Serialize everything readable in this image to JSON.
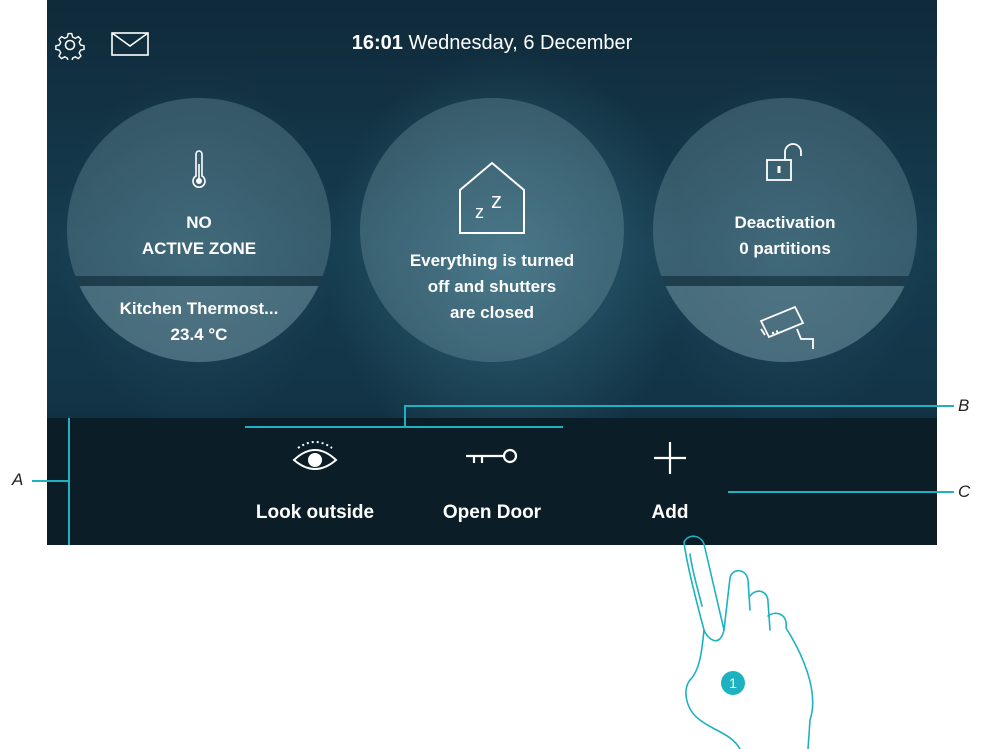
{
  "header": {
    "time": "16:01",
    "date": "Wednesday, 6 December",
    "icons": {
      "settings": "gear-icon",
      "messages": "mail-icon"
    }
  },
  "widgets": {
    "climate": {
      "icon": "thermometer-icon",
      "status_line1": "NO",
      "status_line2": "ACTIVE ZONE",
      "thermostat_name": "Kitchen Thermost...",
      "temperature": "23.4 °C"
    },
    "scenario": {
      "icon": "sleep-house-icon",
      "line1": "Everything is turned",
      "line2": "off and shutters",
      "line3": "are closed"
    },
    "alarm": {
      "icon": "unlocked-padlock-icon",
      "line1": "Deactivation",
      "line2": "0 partitions",
      "lower_icon": "security-camera-icon"
    }
  },
  "actions": [
    {
      "label": "Look outside",
      "icon": "eye-icon"
    },
    {
      "label": "Open Door",
      "icon": "key-icon"
    },
    {
      "label": "Add",
      "icon": "plus-icon"
    }
  ],
  "callouts": {
    "a": "A",
    "b": "B",
    "c": "C",
    "step": "1"
  },
  "colors": {
    "accent": "#1eb2c0",
    "bar": "#0b1e27",
    "text": "#ffffff"
  }
}
